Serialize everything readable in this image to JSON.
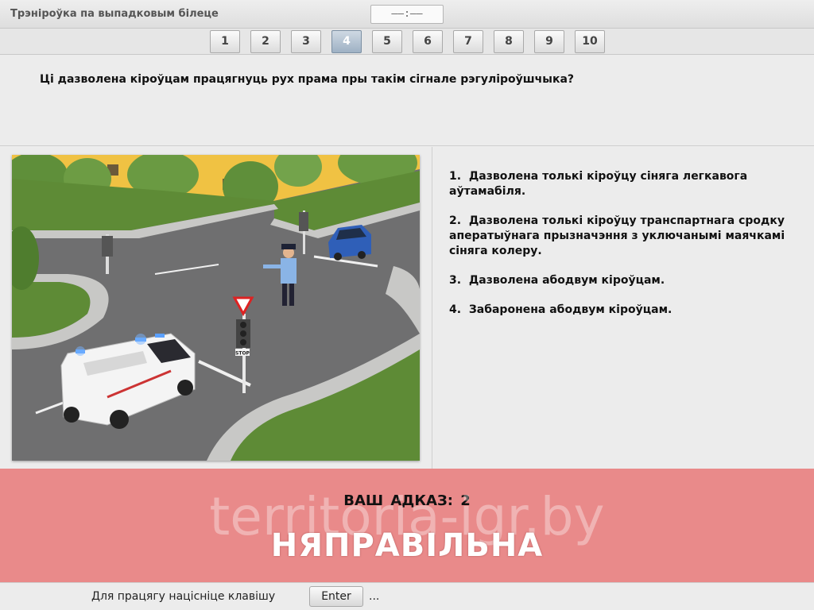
{
  "header": {
    "title": "Трэніроўка па выпадковым білеце",
    "timer": "——:——"
  },
  "question_nav": {
    "items": [
      "1",
      "2",
      "3",
      "4",
      "5",
      "6",
      "7",
      "8",
      "9",
      "10"
    ],
    "active": "4"
  },
  "question": {
    "text": "Ці дазволена кіроўцам працягнуць рух прама пры такім сігнале рэгуліроўшчыка?"
  },
  "scene": {
    "sign_text": "STOP"
  },
  "answers": [
    {
      "number": "1.",
      "text": "Дазволена толькі кіроўцу сіняга легкавога аўтамабіля."
    },
    {
      "number": "2.",
      "text": "Дазволена толькі кіроўцу транспартнага сродку аператыўнага прызначэння з уключанымі маячкамі сіняга колеру."
    },
    {
      "number": "3.",
      "text": "Дазволена абодвум кіроўцам."
    },
    {
      "number": "4.",
      "text": "Забаронена абодвум кіроўцам."
    }
  ],
  "result": {
    "answer_label": "ВАШ АДКАЗ:",
    "answer_value": "2",
    "verdict": "НЯПРАВІЛЬНА",
    "watermark": "territoria-igr.by"
  },
  "footer": {
    "hint": "Для працягу націсніце клавішу",
    "key": "Enter",
    "ellipsis": "..."
  },
  "colors": {
    "result_bg": "#e98a8a",
    "active_tab": "#9eb1c4",
    "car_blue": "#2f5fb8",
    "building_yellow": "#f0c243"
  }
}
